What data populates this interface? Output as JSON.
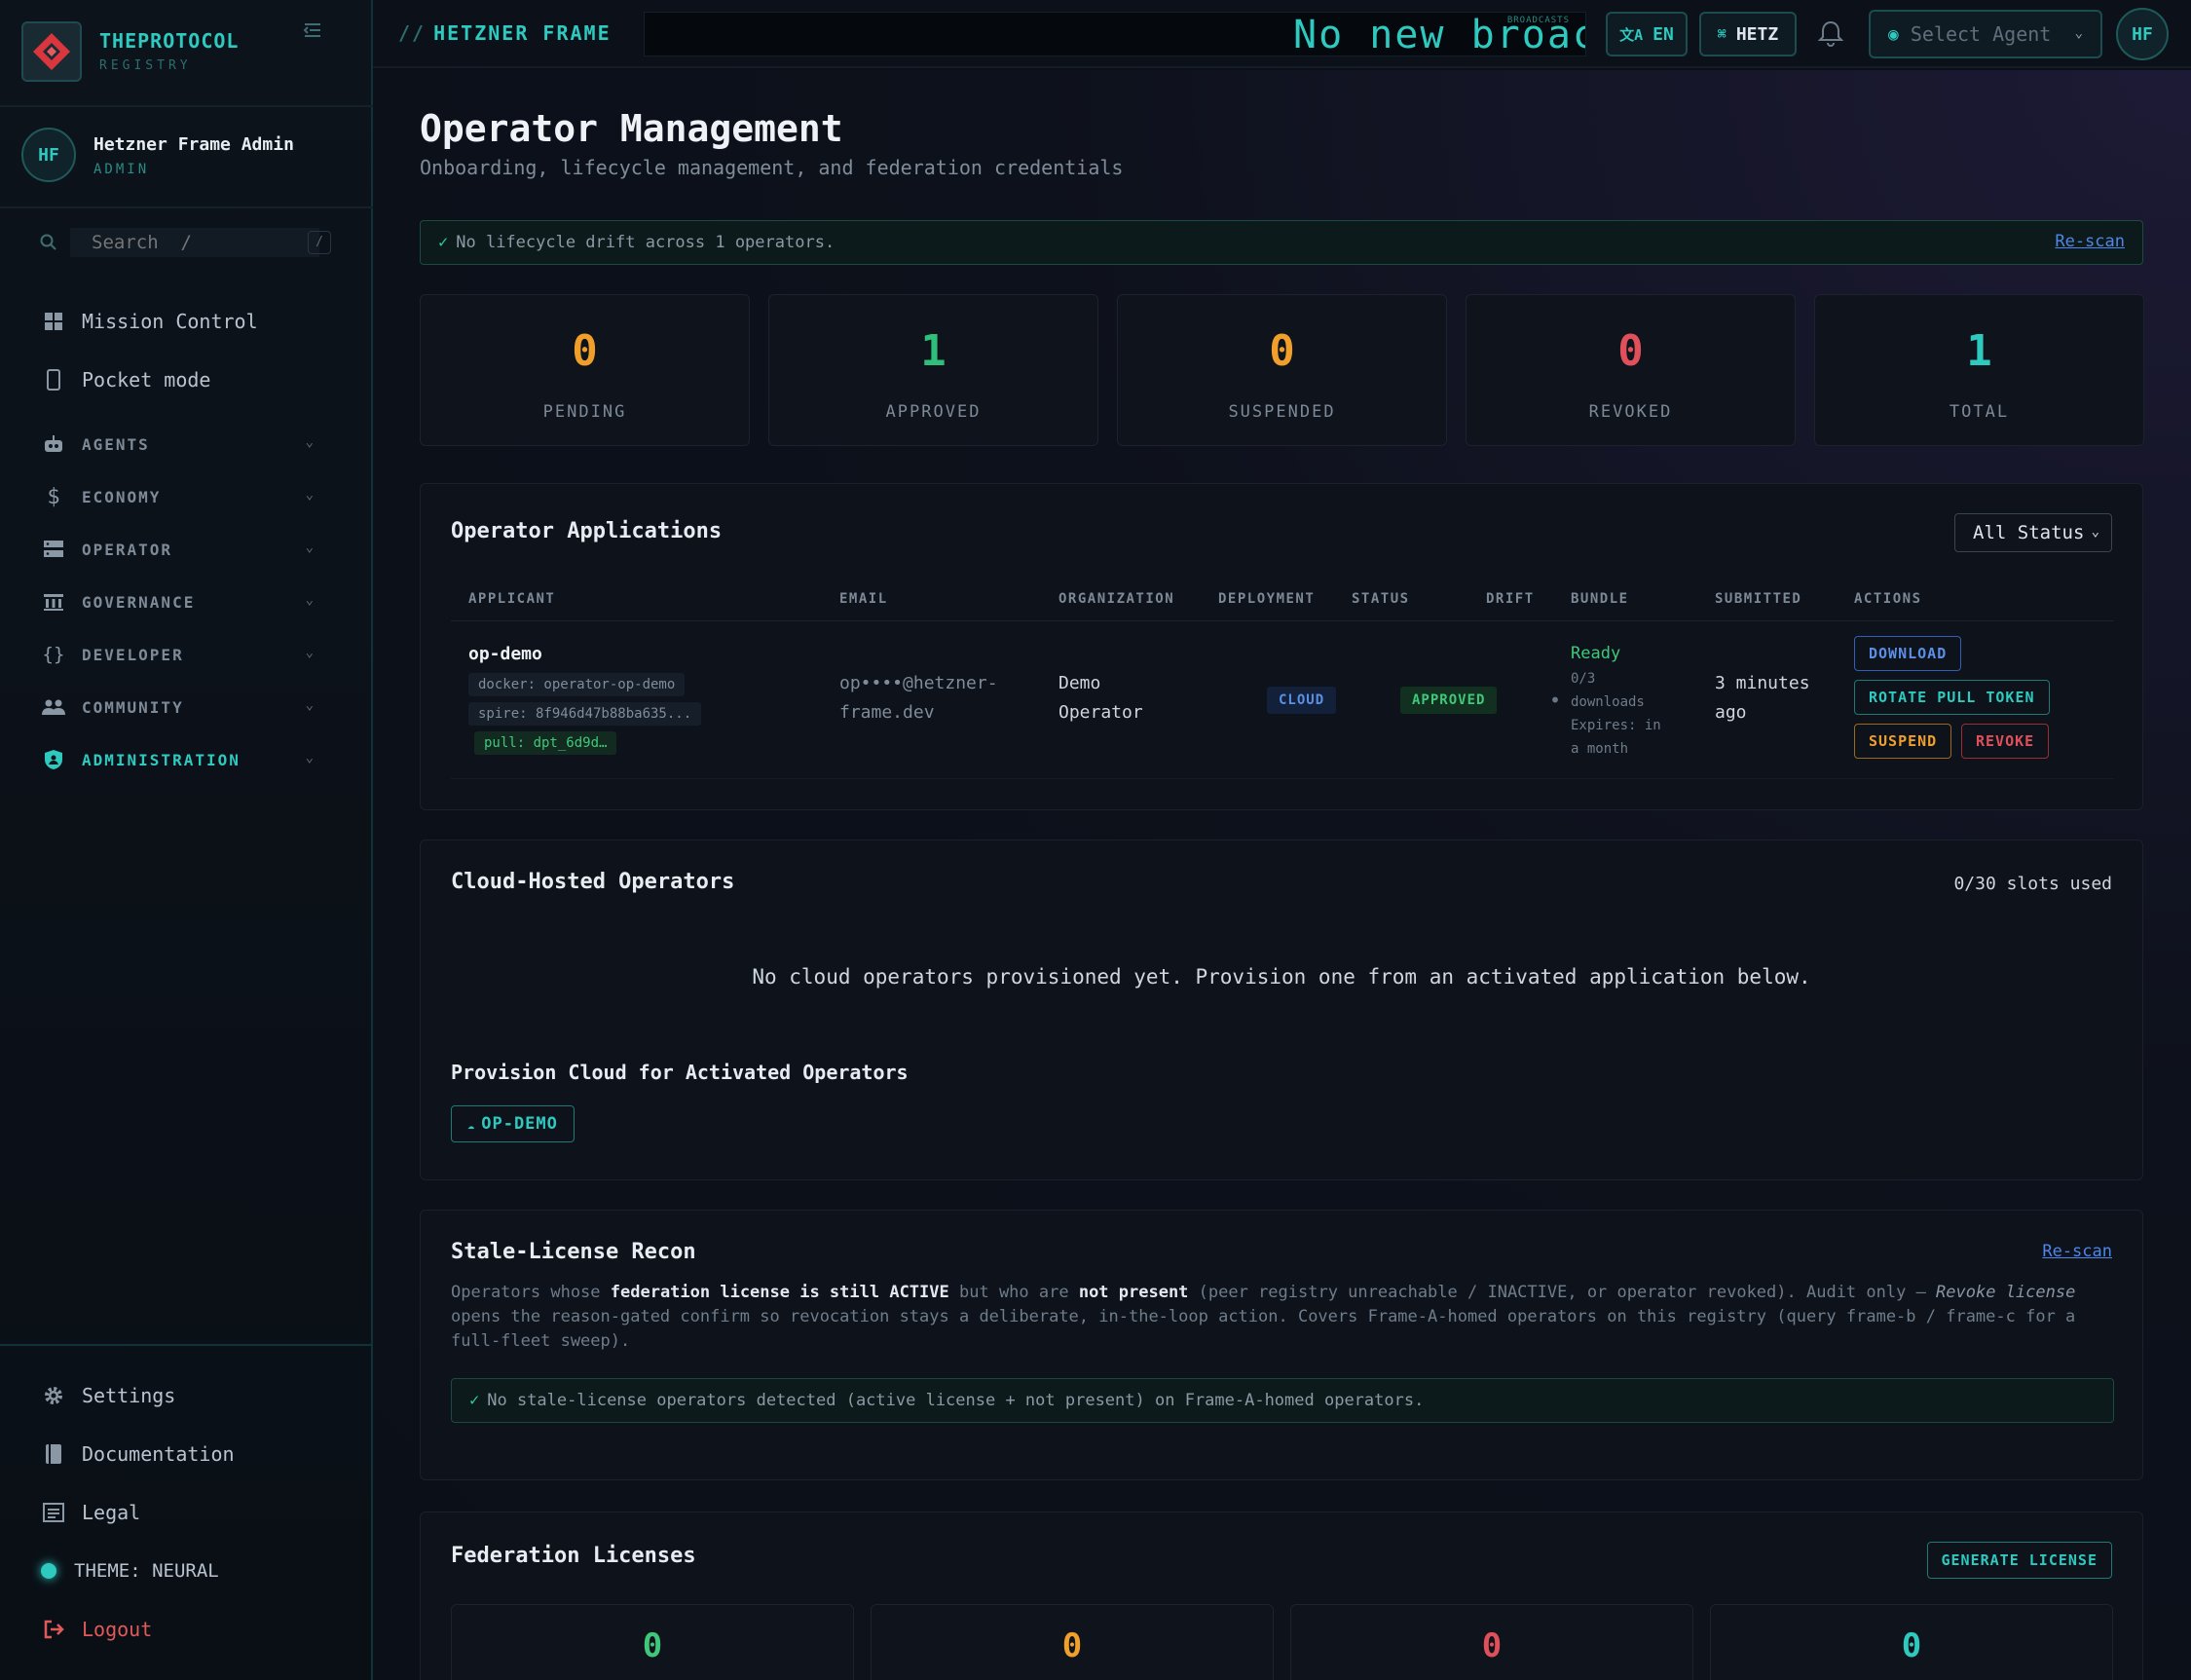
{
  "sidebar": {
    "brand_name": "THEPROTOCOL",
    "brand_sub": "REGISTRY",
    "user_initials": "HF",
    "user_name": "Hetzner Frame Admin",
    "user_role": "ADMIN",
    "search_placeholder": "Search  /",
    "search_kbd": "/",
    "items": [
      {
        "label": "Mission Control",
        "icon": "dashboard-icon"
      },
      {
        "label": "Pocket mode",
        "icon": "phone-icon"
      }
    ],
    "sections": [
      {
        "label": "AGENTS",
        "icon": "robot-icon"
      },
      {
        "label": "ECONOMY",
        "icon": "dollar-icon"
      },
      {
        "label": "OPERATOR",
        "icon": "server-icon"
      },
      {
        "label": "GOVERNANCE",
        "icon": "building-icon"
      },
      {
        "label": "DEVELOPER",
        "icon": "braces-icon"
      },
      {
        "label": "COMMUNITY",
        "icon": "people-icon"
      },
      {
        "label": "ADMINISTRATION",
        "icon": "shield-icon"
      }
    ],
    "footer": {
      "settings": "Settings",
      "documentation": "Documentation",
      "legal": "Legal",
      "theme": "THEME: NEURAL",
      "logout": "Logout"
    }
  },
  "topbar": {
    "crumb_prefix": "//",
    "crumb": "HETZNER FRAME",
    "ticker": "No new broac",
    "ticker_tag": "BROADCASTS",
    "lang": "EN",
    "frame": "HETZ",
    "agent_placeholder": "Select Agent",
    "avatar": "HF"
  },
  "page": {
    "title": "Operator Management",
    "subtitle": "Onboarding, lifecycle management, and federation credentials",
    "drift_text": "No lifecycle drift across 1 operators.",
    "drift_check": "✓",
    "rescan": "Re-scan"
  },
  "stats": [
    {
      "value": "0",
      "label": "PENDING",
      "color": "#f0a02a"
    },
    {
      "value": "1",
      "label": "APPROVED",
      "color": "#2fbf7a"
    },
    {
      "value": "0",
      "label": "SUSPENDED",
      "color": "#f0a02a"
    },
    {
      "value": "0",
      "label": "REVOKED",
      "color": "#e0505a"
    },
    {
      "value": "1",
      "label": "TOTAL",
      "color": "#2ec9bf"
    }
  ],
  "applications": {
    "title": "Operator Applications",
    "filter": "All Status",
    "columns": [
      "APPLICANT",
      "EMAIL",
      "ORGANIZATION",
      "DEPLOYMENT",
      "STATUS",
      "DRIFT",
      "BUNDLE",
      "SUBMITTED",
      "ACTIONS"
    ],
    "row": {
      "applicant": "op-demo",
      "docker": "docker: operator-op-demo",
      "spire": "spire: 8f946d47b88ba635...",
      "pull": "pull: dpt_6d9d…",
      "email_1": "op••••@hetzner-",
      "email_2": "frame.dev",
      "org_1": "Demo",
      "org_2": "Operator",
      "deployment": "CLOUD",
      "status": "APPROVED",
      "drift": "•",
      "bundle_state": "Ready",
      "bundle_l1": "0/3",
      "bundle_l2": "downloads",
      "bundle_l3": "Expires: in",
      "bundle_l4": "a month",
      "submitted_1": "3 minutes",
      "submitted_2": "ago",
      "actions": {
        "download": "DOWNLOAD",
        "rotate": "ROTATE PULL TOKEN",
        "suspend": "SUSPEND",
        "revoke": "REVOKE"
      }
    }
  },
  "cloud": {
    "title": "Cloud-Hosted Operators",
    "slots": "0/30 slots used",
    "empty": "No cloud operators provisioned yet. Provision one from an activated application below.",
    "provision_title": "Provision Cloud for Activated Operators",
    "provision_button": "OP-DEMO"
  },
  "recon": {
    "title": "Stale-License Recon",
    "rescan": "Re-scan",
    "desc_1": "Operators whose ",
    "desc_b1": "federation license is still ACTIVE",
    "desc_2": " but who are ",
    "desc_b2": "not present",
    "desc_3": " (peer registry unreachable / INACTIVE, or operator revoked). Audit only — ",
    "desc_i1": "Revoke license",
    "desc_4": " opens the reason-gated confirm so revocation stays a deliberate, in-the-loop action. Covers Frame-A-homed operators on this registry (query frame-b / frame-c for a full-fleet sweep).",
    "ok": "No stale-license operators detected (active license + not present) on Frame-A-homed operators.",
    "ok_check": "✓"
  },
  "federation": {
    "title": "Federation Licenses",
    "generate": "GENERATE LICENSE",
    "cards": [
      {
        "value": "0",
        "color": "#3fc87a"
      },
      {
        "value": "0",
        "color": "#f0a02a"
      },
      {
        "value": "0",
        "color": "#e0505a"
      },
      {
        "value": "0",
        "color": "#2ec9bf"
      }
    ]
  }
}
